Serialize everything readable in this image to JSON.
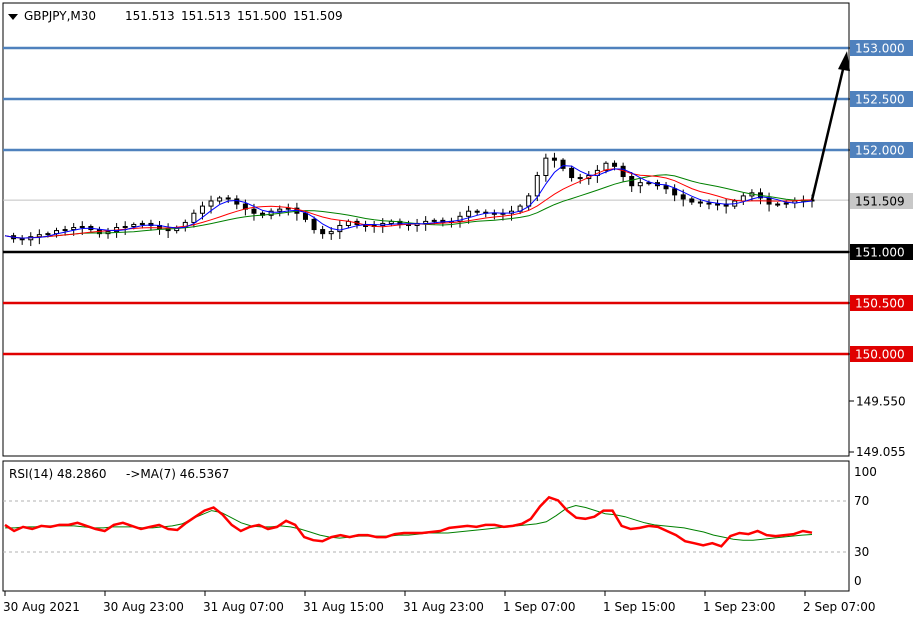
{
  "header": {
    "symbol": "GBPJPY,M30",
    "ohlc": [
      "151.513",
      "151.513",
      "151.500",
      "151.509"
    ]
  },
  "price_axis": {
    "ticks": [
      "153.000",
      "152.500",
      "152.000",
      "151.509",
      "151.000",
      "150.500",
      "150.000",
      "149.550",
      "149.055"
    ]
  },
  "rsi_panel": {
    "title": "RSI(14) 48.2860",
    "ma_title": "->MA(7) 46.5367",
    "ticks": [
      "100",
      "70",
      "30",
      "0"
    ]
  },
  "time_axis": {
    "labels": [
      "30 Aug 2021",
      "30 Aug 23:00",
      "31 Aug 07:00",
      "31 Aug 15:00",
      "31 Aug 23:00",
      "1 Sep 07:00",
      "1 Sep 15:00",
      "1 Sep 23:00",
      "2 Sep 07:00"
    ]
  },
  "colors": {
    "resistance": "#4f81bd",
    "support_red": "#e00000",
    "pivot": "#000000",
    "current": "#c0c0c0",
    "ma_fast": "#0000ff",
    "ma_mid": "#ff0000",
    "ma_slow": "#008000",
    "rsi": "#ff0000",
    "rsi_ma": "#008000"
  },
  "chart_data": {
    "type": "candlestick",
    "symbol": "GBPJPY",
    "timeframe": "M30",
    "current_price": 151.509,
    "levels": [
      {
        "price": 153.0,
        "label": "153.000",
        "color": "#4f81bd"
      },
      {
        "price": 152.5,
        "label": "152.500",
        "color": "#4f81bd"
      },
      {
        "price": 152.0,
        "label": "152.000",
        "color": "#4f81bd"
      },
      {
        "price": 151.0,
        "label": "151.000",
        "color": "#000000"
      },
      {
        "price": 150.5,
        "label": "150.500",
        "color": "#e00000"
      },
      {
        "price": 150.0,
        "label": "150.000",
        "color": "#e00000"
      }
    ],
    "price_path": [
      151.16,
      151.13,
      151.12,
      151.15,
      151.17,
      151.18,
      151.21,
      151.22,
      151.24,
      151.25,
      151.22,
      151.18,
      151.2,
      151.24,
      151.25,
      151.27,
      151.28,
      151.26,
      151.23,
      151.21,
      151.24,
      151.29,
      151.38,
      151.45,
      151.5,
      151.53,
      151.52,
      151.47,
      151.42,
      151.38,
      151.36,
      151.4,
      151.42,
      151.43,
      151.38,
      151.32,
      151.22,
      151.18,
      151.2,
      151.26,
      151.3,
      151.27,
      151.25,
      151.26,
      151.28,
      151.3,
      151.27,
      151.26,
      151.28,
      151.3,
      151.31,
      151.29,
      151.3,
      151.35,
      151.4,
      151.39,
      151.38,
      151.37,
      151.38,
      151.4,
      151.45,
      151.55,
      151.75,
      151.92,
      151.9,
      151.82,
      151.73,
      151.72,
      151.75,
      151.8,
      151.87,
      151.84,
      151.74,
      151.65,
      151.68,
      151.68,
      151.65,
      151.62,
      151.56,
      151.52,
      151.49,
      151.48,
      151.47,
      151.47,
      151.45,
      151.5,
      151.55,
      151.58,
      151.53,
      151.47,
      151.47,
      151.48,
      151.5,
      151.51,
      151.509
    ],
    "projection": {
      "from": 151.509,
      "to": 152.93
    },
    "rsi": {
      "values": [
        56,
        50,
        54,
        52,
        55,
        54,
        56,
        56,
        58,
        55,
        52,
        50,
        56,
        58,
        55,
        52,
        54,
        56,
        52,
        51,
        58,
        64,
        70,
        73,
        66,
        56,
        50,
        54,
        56,
        52,
        54,
        60,
        56,
        44,
        41,
        40,
        44,
        46,
        44,
        46,
        46,
        44,
        44,
        47,
        48,
        48,
        48,
        49,
        50,
        53,
        54,
        55,
        54,
        56,
        56,
        54,
        55,
        57,
        62,
        74,
        83,
        80,
        70,
        63,
        62,
        64,
        70,
        70,
        55,
        52,
        53,
        55,
        54,
        50,
        46,
        40,
        38,
        36,
        38,
        35,
        45,
        48,
        47,
        50,
        46,
        45,
        46,
        47,
        50,
        48.286
      ],
      "ma": [
        53,
        53,
        54,
        54,
        55,
        55,
        55,
        55,
        54,
        53,
        53,
        54,
        54,
        54,
        53,
        53,
        54,
        55,
        57,
        62,
        66,
        70,
        68,
        63,
        58,
        55,
        54,
        54,
        55,
        54,
        52,
        49,
        46,
        44,
        43,
        44,
        45,
        45,
        45,
        45,
        46,
        46,
        47,
        48,
        48,
        48,
        49,
        50,
        51,
        52,
        53,
        54,
        55,
        56,
        57,
        59,
        65,
        72,
        75,
        73,
        70,
        67,
        66,
        64,
        61,
        58,
        56,
        55,
        54,
        53,
        51,
        49,
        46,
        44,
        42,
        41,
        41,
        42,
        43,
        44,
        45,
        46,
        46.5367
      ],
      "levels": [
        70,
        30
      ],
      "range": [
        0,
        100
      ]
    }
  }
}
